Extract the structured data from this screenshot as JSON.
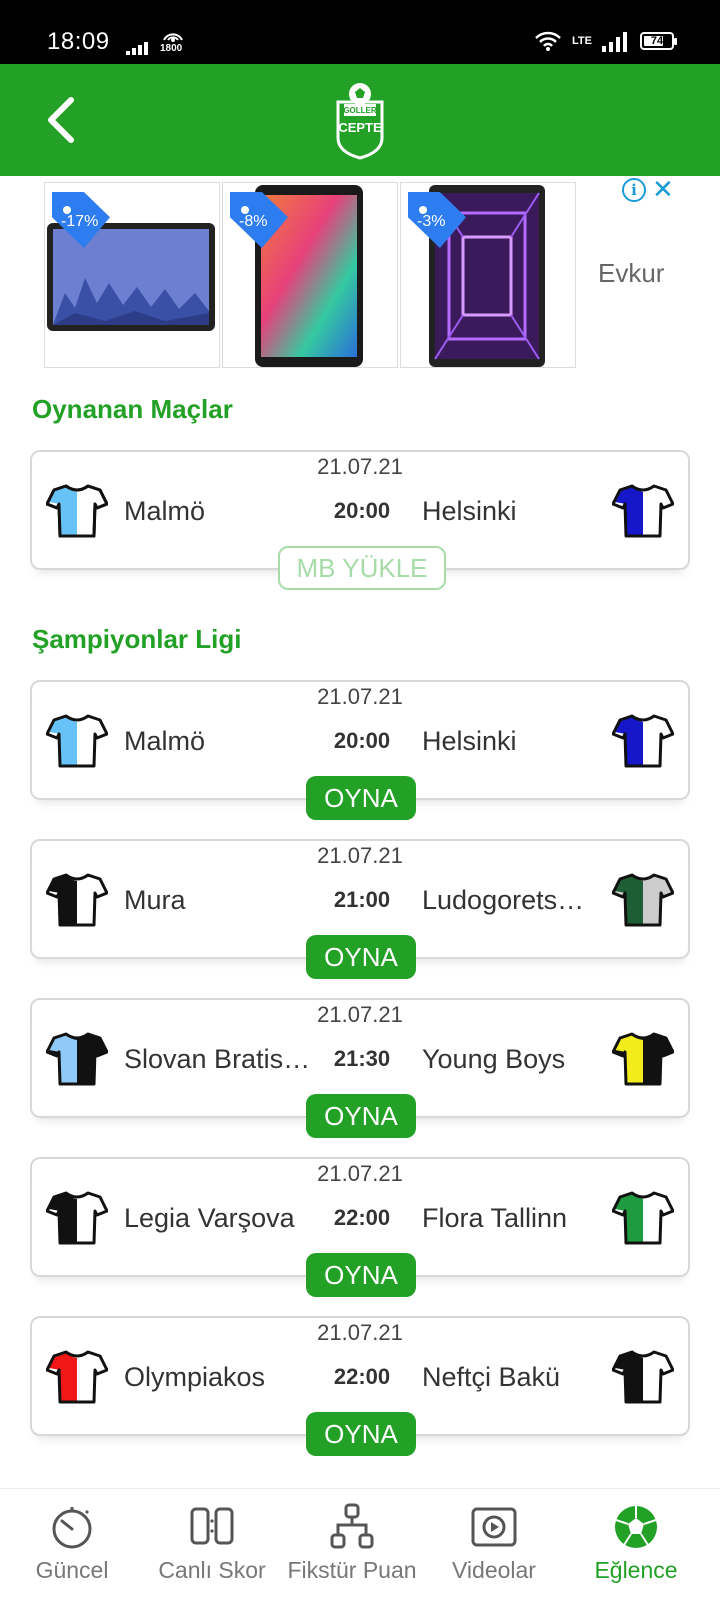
{
  "status_bar": {
    "time": "18:09",
    "network_speed": "1800",
    "network_type": "LTE",
    "battery": "74"
  },
  "header": {
    "logo_top": "GOLLER",
    "logo_main": "CEPTE"
  },
  "ad": {
    "items": [
      {
        "discount": "-17%"
      },
      {
        "discount": "-8%"
      },
      {
        "discount": "-3%"
      }
    ],
    "brand": "Evkur",
    "info_icon": "i",
    "close_icon": "✕"
  },
  "sections": {
    "played": {
      "title": "Oynanan Maçlar"
    },
    "league": {
      "title": "Şampiyonlar Ligi"
    }
  },
  "played_matches": [
    {
      "date": "21.07.21",
      "time": "20:00",
      "home": "Malmö",
      "away": "Helsinki",
      "button": "MB YÜKLE"
    }
  ],
  "league_matches": [
    {
      "date": "21.07.21",
      "time": "20:00",
      "home": "Malmö",
      "away": "Helsinki",
      "button": "OYNA"
    },
    {
      "date": "21.07.21",
      "time": "21:00",
      "home": "Mura",
      "away": "Ludogorets…",
      "button": "OYNA"
    },
    {
      "date": "21.07.21",
      "time": "21:30",
      "home": "Slovan Bratis…",
      "away": "Young Boys",
      "button": "OYNA"
    },
    {
      "date": "21.07.21",
      "time": "22:00",
      "home": "Legia Varşova",
      "away": "Flora Tallinn",
      "button": "OYNA"
    },
    {
      "date": "21.07.21",
      "time": "22:00",
      "home": "Olympiakos",
      "away": "Neftçi Bakü",
      "button": "OYNA"
    }
  ],
  "bottom_nav": [
    {
      "label": "Güncel",
      "icon": "stopwatch-icon"
    },
    {
      "label": "Canlı Skor",
      "icon": "scoreboard-icon"
    },
    {
      "label": "Fikstür Puan",
      "icon": "fixture-tree-icon"
    },
    {
      "label": "Videolar",
      "icon": "play-video-icon"
    },
    {
      "label": "Eğlence",
      "icon": "soccer-ball-icon",
      "active": true
    }
  ],
  "colors": {
    "brand_green": "#22a126",
    "ad_badge_blue": "#2d7df0",
    "muted_green": "#a7dca8"
  }
}
